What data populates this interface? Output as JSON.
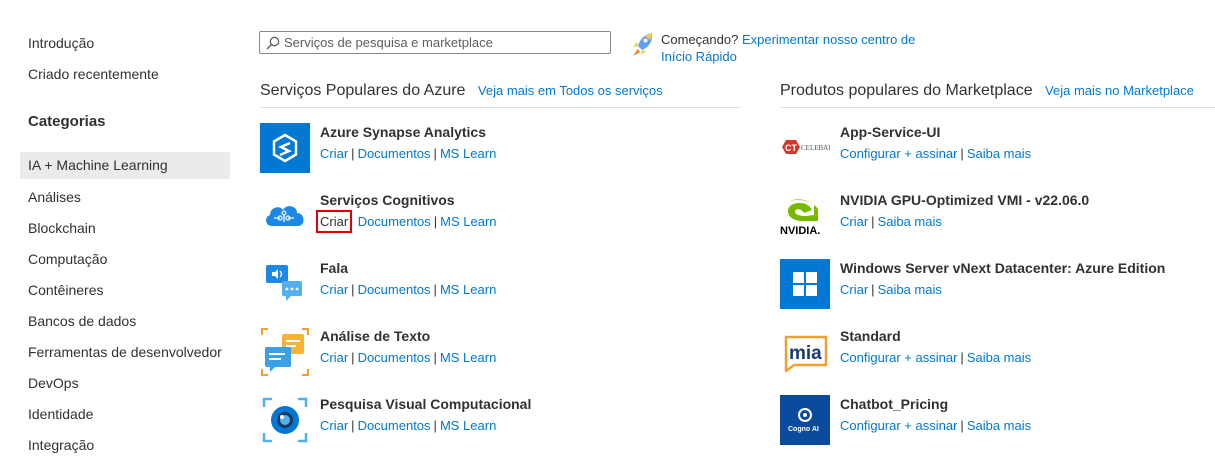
{
  "sidebar": {
    "links": [
      "Introdução",
      "Criado recentemente"
    ],
    "categories_heading": "Categorias",
    "categories": [
      "IA + Machine Learning",
      "Análises",
      "Blockchain",
      "Computação",
      "Contêineres",
      "Bancos de dados",
      "Ferramentas de desenvolvedor",
      "DevOps",
      "Identidade",
      "Integração"
    ],
    "selected": "IA + Machine Learning"
  },
  "search": {
    "placeholder": "Serviços de pesquisa e marketplace"
  },
  "quickstart": {
    "prefix": "Começando?",
    "link": "Experimentar nosso centro de Início Rápido"
  },
  "popular_services": {
    "title": "Serviços Populares do Azure",
    "more_link": "Veja mais em Todos os serviços",
    "items": [
      {
        "name": "Azure Synapse Analytics",
        "icon": "synapse-icon",
        "actions": [
          "Criar",
          "Documentos",
          "MS Learn"
        ]
      },
      {
        "name": "Serviços Cognitivos",
        "icon": "cognitive-services-icon",
        "actions": [
          "Criar",
          "Documentos",
          "MS Learn"
        ]
      },
      {
        "name": "Fala",
        "icon": "speech-icon",
        "actions": [
          "Criar",
          "Documentos",
          "MS Learn"
        ]
      },
      {
        "name": "Análise de Texto",
        "icon": "text-analytics-icon",
        "actions": [
          "Criar",
          "Documentos",
          "MS Learn"
        ]
      },
      {
        "name": "Pesquisa Visual Computacional",
        "icon": "computer-vision-icon",
        "actions": [
          "Criar",
          "Documentos",
          "MS Learn"
        ]
      }
    ]
  },
  "marketplace": {
    "title": "Produtos populares do Marketplace",
    "more_link": "Veja mais no Marketplace",
    "items": [
      {
        "name": "App-Service-UI",
        "icon": "celebal-logo-icon",
        "logo_text": "CELEBAL",
        "actions": [
          "Configurar + assinar",
          "Saiba mais"
        ]
      },
      {
        "name": "NVIDIA GPU-Optimized VMI - v22.06.0",
        "icon": "nvidia-logo-icon",
        "logo_text": "NVIDIA.",
        "actions": [
          "Criar",
          "Saiba mais"
        ]
      },
      {
        "name": "Windows Server vNext Datacenter: Azure Edition",
        "icon": "windows-logo-icon",
        "actions": [
          "Criar",
          "Saiba mais"
        ]
      },
      {
        "name": "Standard",
        "icon": "mia-logo-icon",
        "logo_text": "mia",
        "actions": [
          "Configurar + assinar",
          "Saiba mais"
        ]
      },
      {
        "name": "Chatbot_Pricing",
        "icon": "cogno-ai-logo-icon",
        "logo_text": "Cogno AI",
        "actions": [
          "Configurar + assinar",
          "Saiba mais"
        ]
      }
    ]
  },
  "colors": {
    "link": "#0078d4",
    "text": "#323130",
    "selected_bg": "#ebebeb",
    "highlight": "#e00000"
  }
}
